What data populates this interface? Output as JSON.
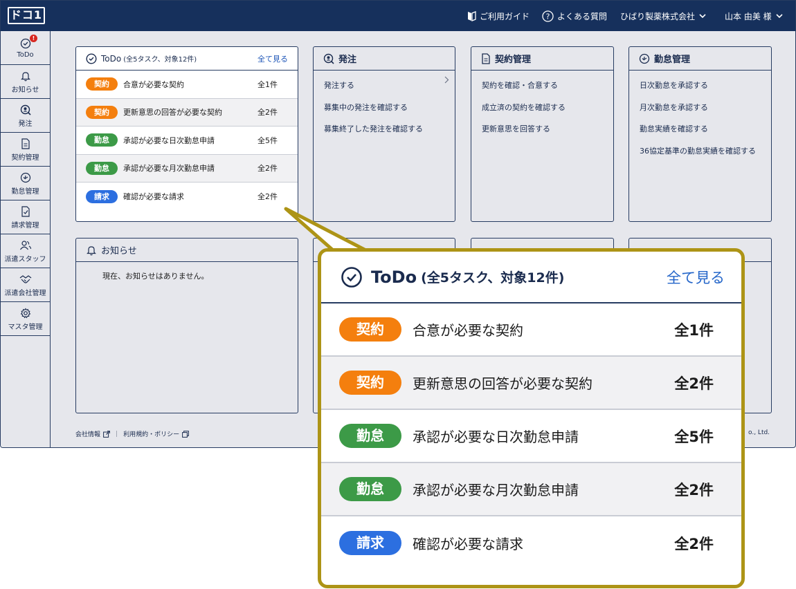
{
  "header": {
    "logo": "ドコ1",
    "guide": "ご利用ガイド",
    "faq": "よくある質問",
    "company": "ひばり製薬株式会社",
    "user": "山本 由美 様"
  },
  "sidebar": {
    "badge": "!",
    "items": [
      {
        "label": "ToDo"
      },
      {
        "label": "お知らせ"
      },
      {
        "label": "発注"
      },
      {
        "label": "契約管理"
      },
      {
        "label": "勤怠管理"
      },
      {
        "label": "請求管理"
      },
      {
        "label": "派遣スタッフ"
      },
      {
        "label": "派遣会社管理"
      },
      {
        "label": "マスタ管理"
      }
    ]
  },
  "todo": {
    "title": "ToDo",
    "summary": "(全5タスク、対象12件)",
    "view_all": "全て見る",
    "rows": [
      {
        "tag": "契約",
        "label": "合意が必要な契約",
        "count": "全1件"
      },
      {
        "tag": "契約",
        "label": "更新意思の回答が必要な契約",
        "count": "全2件"
      },
      {
        "tag": "勤怠",
        "label": "承認が必要な日次勤怠申請",
        "count": "全5件"
      },
      {
        "tag": "勤怠",
        "label": "承認が必要な月次勤怠申請",
        "count": "全2件"
      },
      {
        "tag": "請求",
        "label": "確認が必要な請求",
        "count": "全2件"
      }
    ]
  },
  "cards": {
    "order": {
      "title": "発注",
      "links": [
        "発注する",
        "募集中の発注を確認する",
        "募集終了した発注を確認する"
      ]
    },
    "contract": {
      "title": "契約管理",
      "links": [
        "契約を確認・合意する",
        "成立済の契約を確認する",
        "更新意思を回答する"
      ]
    },
    "attendance": {
      "title": "勤怠管理",
      "links": [
        "日次勤怠を承認する",
        "月次勤怠を承認する",
        "勤怠実績を確認する",
        "36協定基準の勤怠実績を確認する"
      ]
    },
    "notice": {
      "title": "お知らせ",
      "empty": "現在、お知らせはありません。"
    }
  },
  "footer": {
    "company_info": "会社情報",
    "terms": "利用規約・ポリシー",
    "separator": "|",
    "copyright": "o., Ltd."
  },
  "colors": {
    "header_bg": "#16305c",
    "tag_contract": "#f47f0e",
    "tag_attendance": "#3c9a47",
    "tag_billing": "#2c6fe0",
    "callout_border": "#ad9416",
    "link": "#2057b8"
  }
}
